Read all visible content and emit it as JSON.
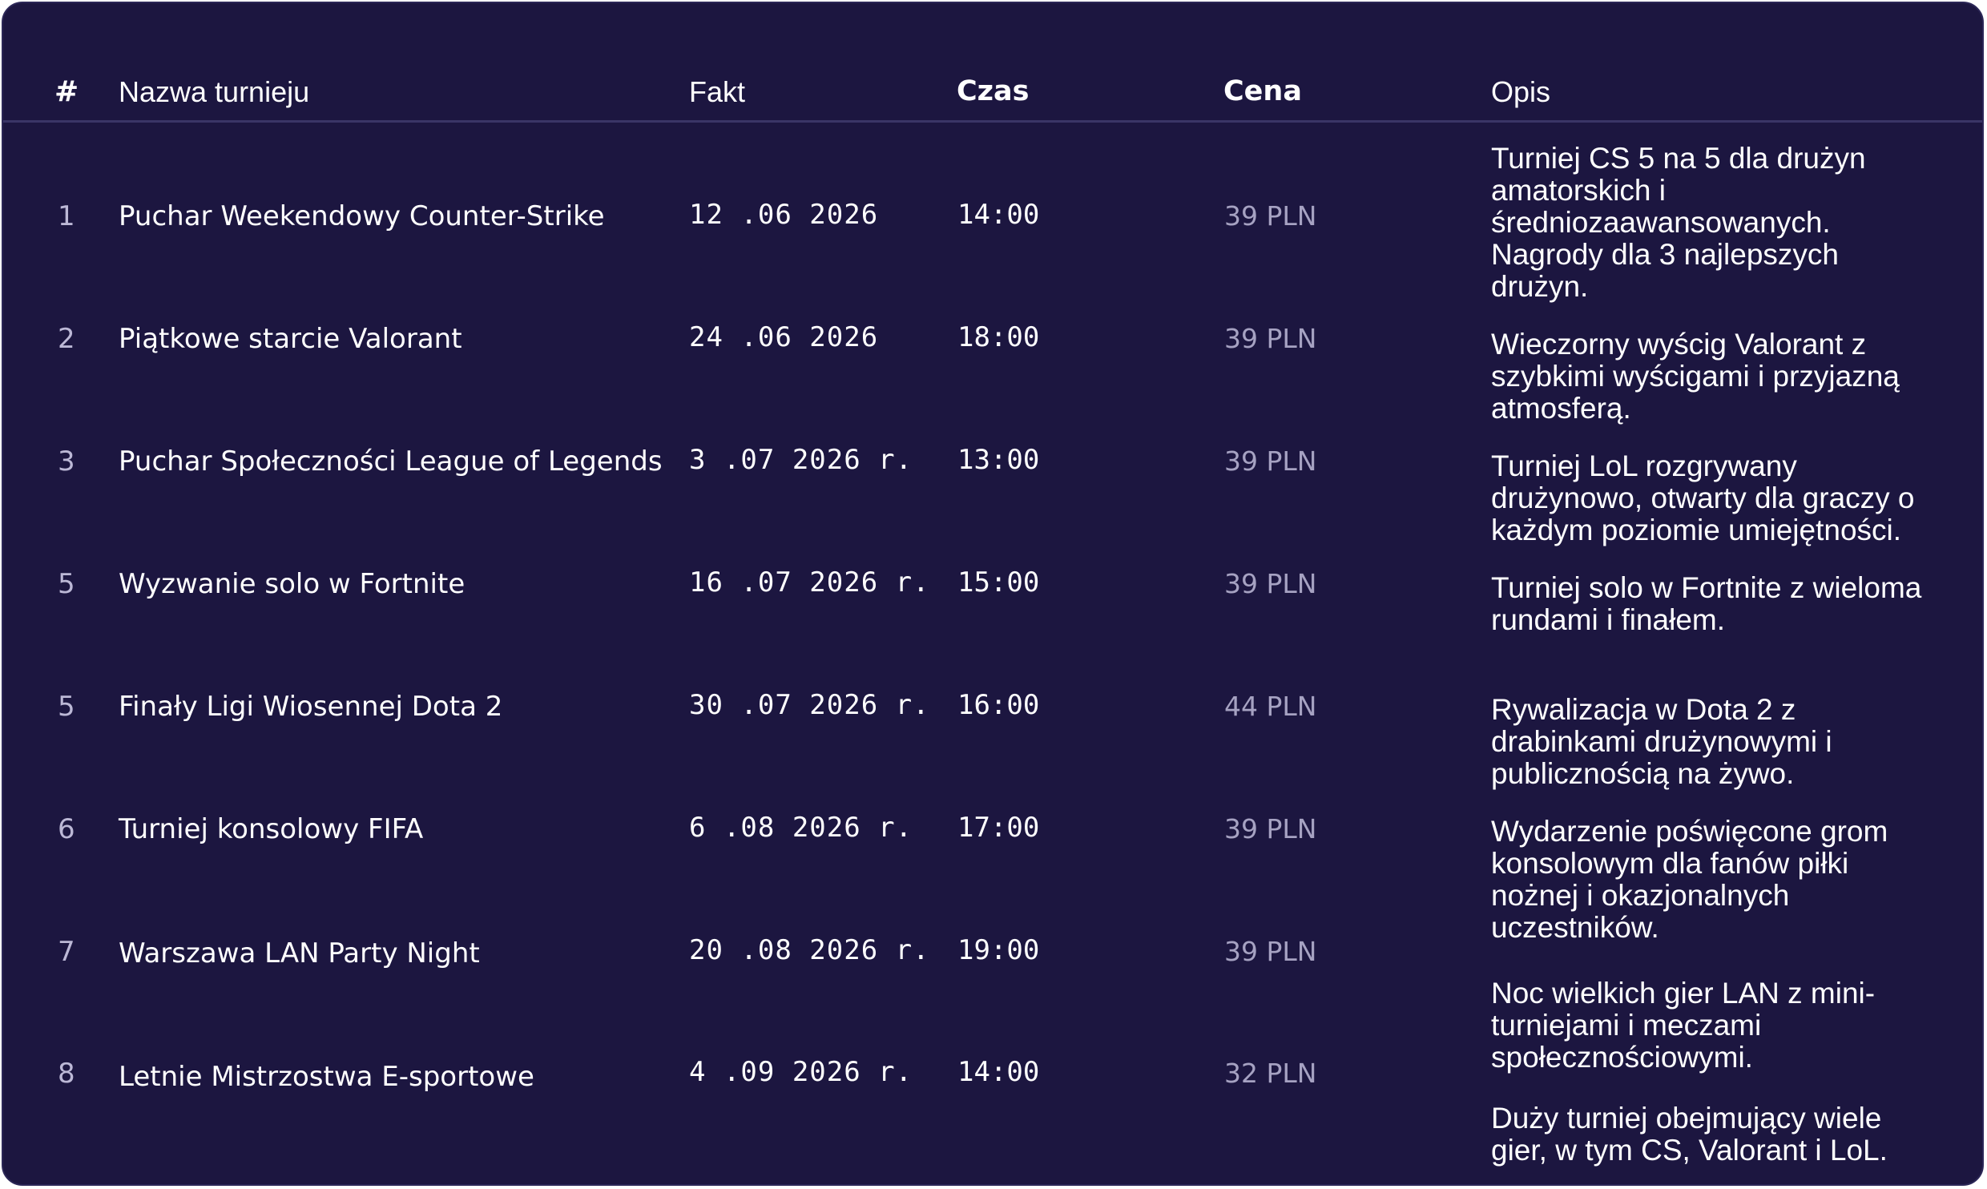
{
  "table": {
    "headers": {
      "index": "#",
      "name": "Nazwa turnieju",
      "date": "Fakt",
      "time": "Czas",
      "price": "Cena",
      "description": "Opis"
    },
    "rows": [
      {
        "index": "1",
        "name": "Puchar Weekendowy Counter-Strike",
        "date": "12 .06 2026",
        "time": "14:00",
        "price": "39 PLN"
      },
      {
        "index": "2",
        "name": "Piątkowe starcie Valorant",
        "date": "24 .06 2026",
        "time": "18:00",
        "price": "39 PLN"
      },
      {
        "index": "3",
        "name": "Puchar Społeczności League of Legends",
        "date": "3 .07 2026 r.",
        "time": "13:00",
        "price": "39 PLN"
      },
      {
        "index": "5",
        "name": "Wyzwanie solo w Fortnite",
        "date": "16 .07 2026 r.",
        "time": "15:00",
        "price": "39 PLN"
      },
      {
        "index": "5",
        "name": "Finały Ligi Wiosennej Dota 2",
        "date": "30 .07 2026 r.",
        "time": "16:00",
        "price": "44 PLN"
      },
      {
        "index": "6",
        "name": "Turniej konsolowy FIFA",
        "date": "6 .08 2026 r.",
        "time": "17:00",
        "price": "39 PLN"
      },
      {
        "index": "7",
        "name": "Warszawa LAN Party Night",
        "date": "20 .08 2026 r.",
        "time": "19:00",
        "price": "39 PLN"
      },
      {
        "index": "8",
        "name": "Letnie Mistrzostwa E-sportowe",
        "date": "4 .09 2026 r.",
        "time": "14:00",
        "price": "32 PLN"
      }
    ],
    "descriptions": [
      "Turniej CS 5 na 5 dla drużyn amatorskich i średniozaawansowanych. Nagrody dla 3 najlepszych drużyn.",
      "Wieczorny wyścig Valorant z szybkimi wyścigami i przyjazną atmosferą.",
      "Turniej LoL rozgrywany drużynowo, otwarty dla graczy o każdym poziomie umiejętności.",
      "Turniej solo w Fortnite z wieloma rundami i finałem.",
      "Rywalizacja w Dota 2 z drabinkami drużynowymi i publicznością na żywo.",
      "Wydarzenie poświęcone grom konsolowym dla fanów piłki nożnej i okazjonalnych uczestników.",
      "Noc wielkich gier LAN z mini-turniejami i meczami społecznościowymi.",
      "Duży turniej obejmujący wiele gier, w tym CS, Valorant i LoL."
    ]
  },
  "colors": {
    "background": "#1c1640",
    "header_rule": "#3a3566",
    "text": "#ffffff",
    "muted": "#a6a2c2"
  }
}
